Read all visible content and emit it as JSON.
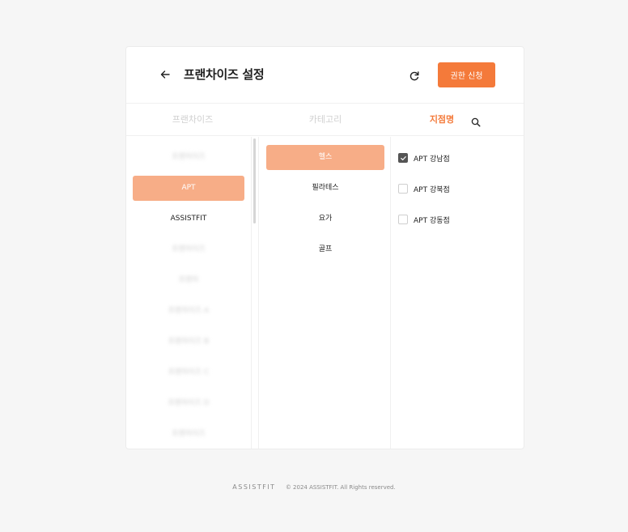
{
  "header": {
    "title": "프랜차이즈 설정",
    "apply_label": "권한 신청"
  },
  "tabs": [
    {
      "label": "프랜차이즈",
      "active": false
    },
    {
      "label": "카테고리",
      "active": false
    },
    {
      "label": "지점명",
      "active": true
    }
  ],
  "franchises": [
    {
      "label": "프랜차이즈",
      "state": "blurred"
    },
    {
      "label": "APT",
      "state": "selected"
    },
    {
      "label": "ASSISTFIT",
      "state": "normal"
    },
    {
      "label": "프랜차이즈",
      "state": "blurred"
    },
    {
      "label": "프랜차",
      "state": "blurred"
    },
    {
      "label": "프랜차이즈 A",
      "state": "blurred"
    },
    {
      "label": "프랜차이즈 B",
      "state": "blurred"
    },
    {
      "label": "프랜차이즈 C",
      "state": "blurred"
    },
    {
      "label": "프랜차이즈 D",
      "state": "blurred"
    },
    {
      "label": "프랜차이즈",
      "state": "blurred"
    }
  ],
  "categories": [
    {
      "label": "헬스",
      "state": "selected"
    },
    {
      "label": "필라테스",
      "state": "normal"
    },
    {
      "label": "요가",
      "state": "normal"
    },
    {
      "label": "골프",
      "state": "normal"
    }
  ],
  "branches": [
    {
      "label": "APT 강남점",
      "checked": true
    },
    {
      "label": "APT 강북점",
      "checked": false
    },
    {
      "label": "APT 강동점",
      "checked": false
    }
  ],
  "footer": {
    "logo": "ASSISTFIT",
    "copyright": "© 2024 ASSISTFIT. All Rights reserved."
  },
  "colors": {
    "accent": "#f47a3a",
    "selected_bg": "#f7ad87"
  },
  "icons": {
    "back": "arrow-left-icon",
    "refresh": "refresh-icon",
    "search": "search-icon",
    "check": "check-icon"
  }
}
